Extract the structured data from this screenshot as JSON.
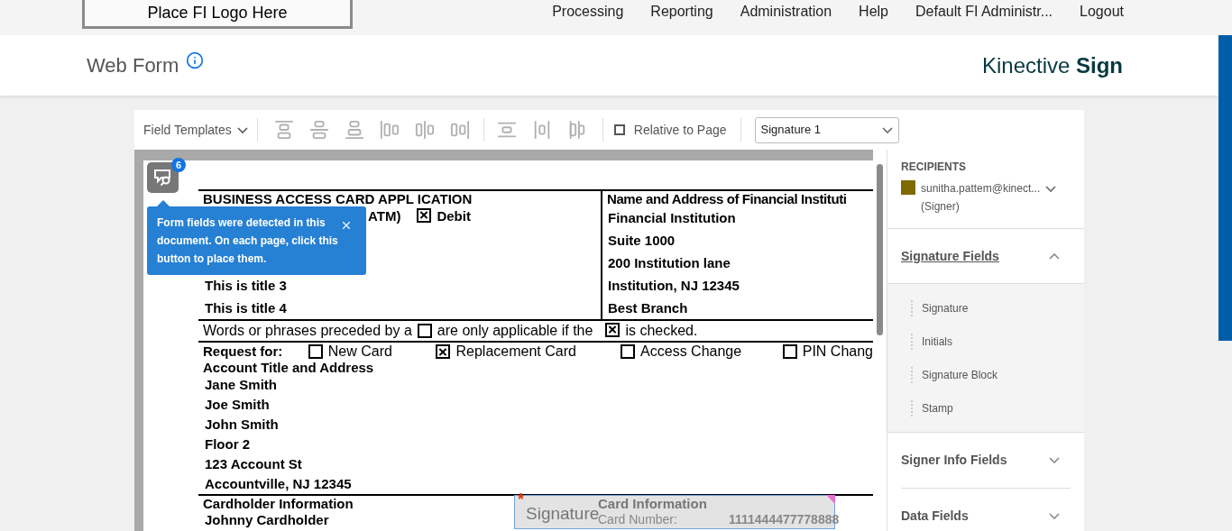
{
  "nav": {
    "logo": "Place FI Logo Here",
    "items": [
      "Processing",
      "Reporting",
      "Administration",
      "Help",
      "Default FI Administr...",
      "Logout"
    ]
  },
  "header": {
    "title": "Web Form",
    "brand": "Kinective **Sign**"
  },
  "toolbar": {
    "templates": "Field Templates",
    "relative": {
      "label": "Relative to Page",
      "checked": false
    },
    "dropdown": "Signature 1"
  },
  "tooltip": {
    "badge": "6",
    "message": "Form fields were detected in this document. On each page, click this button to place them."
  },
  "document": {
    "heading": "BUSINESS ACCESS CARD APPL ICATION",
    "atm": "ATM)",
    "debit": {
      "label": "Debit",
      "checked": true
    },
    "titles": [
      "This is title 3",
      "This is title 4"
    ],
    "fi_heading": "Name and Address of Financial Instituti",
    "fi_lines": [
      "Financial Institution",
      "Suite 1000",
      "200 Institution lane",
      "Institution, NJ 12345",
      "Best Branch"
    ],
    "note": {
      "before": "Words or phrases preceded by a",
      "box1": false,
      "middle": "are only applicable if the",
      "box2": true,
      "after": "is checked."
    },
    "request_label": "Request for:",
    "options": [
      {
        "label": "New Card",
        "checked": false
      },
      {
        "label": "Replacement Card",
        "checked": true
      },
      {
        "label": "Access Change",
        "checked": false
      },
      {
        "label": "PIN Chang",
        "checked": false
      }
    ],
    "account_heading": "Account Title and Address",
    "account_lines": [
      "Jane Smith",
      "Joe Smith",
      "John Smith",
      "Floor 2",
      "123 Account St",
      "Accountville, NJ 12345"
    ],
    "cardholder_heading": "Cardholder Information",
    "cardholder": "Johnny Cardholder",
    "card_info": "Card Information",
    "card_number_label": "Card Number:",
    "card_number": "1111444477778888",
    "signature_field": {
      "label": "Signature",
      "required_mark": "*"
    }
  },
  "sidebar": {
    "recipients_heading": "RECIPIENTS",
    "recipient": {
      "email": "sunitha.pattem@kinect...",
      "role": "(Signer)",
      "color": "#7f6a00"
    },
    "sections": [
      {
        "title": "Signature Fields",
        "expanded": true,
        "items": [
          "Signature",
          "Initials",
          "Signature Block",
          "Stamp"
        ]
      },
      {
        "title": "Signer Info Fields",
        "expanded": false
      },
      {
        "title": "Data Fields",
        "expanded": false
      }
    ]
  }
}
